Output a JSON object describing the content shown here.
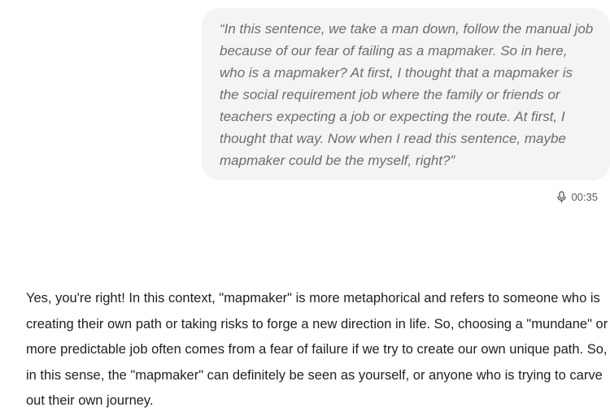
{
  "conversation": {
    "user_message": {
      "text": "“In this sentence, we take a man down, follow the manual job because of our fear of failing as a mapmaker. So in here, who is a mapmaker? At first, I thought that a mapmaker is the social requirement job where the family or friends or teachers expecting a job or expecting the route. At first, I thought that way. Now when I read this sentence, maybe mapmaker could be the myself, right?”",
      "voice_icon": "microphone-icon",
      "duration": "00:35"
    },
    "assistant_message": {
      "text": "Yes, you're right! In this context, \"mapmaker\" is more metaphorical and refers to someone who is creating their own path or taking risks to forge a new direction in life. So, choosing a \"mundane\" or more predictable job often comes from a fear of failure if we try to create our own unique path. So, in this sense, the \"mapmaker\" can definitely be seen as yourself, or anyone who is trying to carve out their own journey."
    }
  },
  "colors": {
    "bubble_bg": "#f4f4f4",
    "user_text": "#6d6d6d",
    "assistant_text": "#1f1f1f"
  }
}
